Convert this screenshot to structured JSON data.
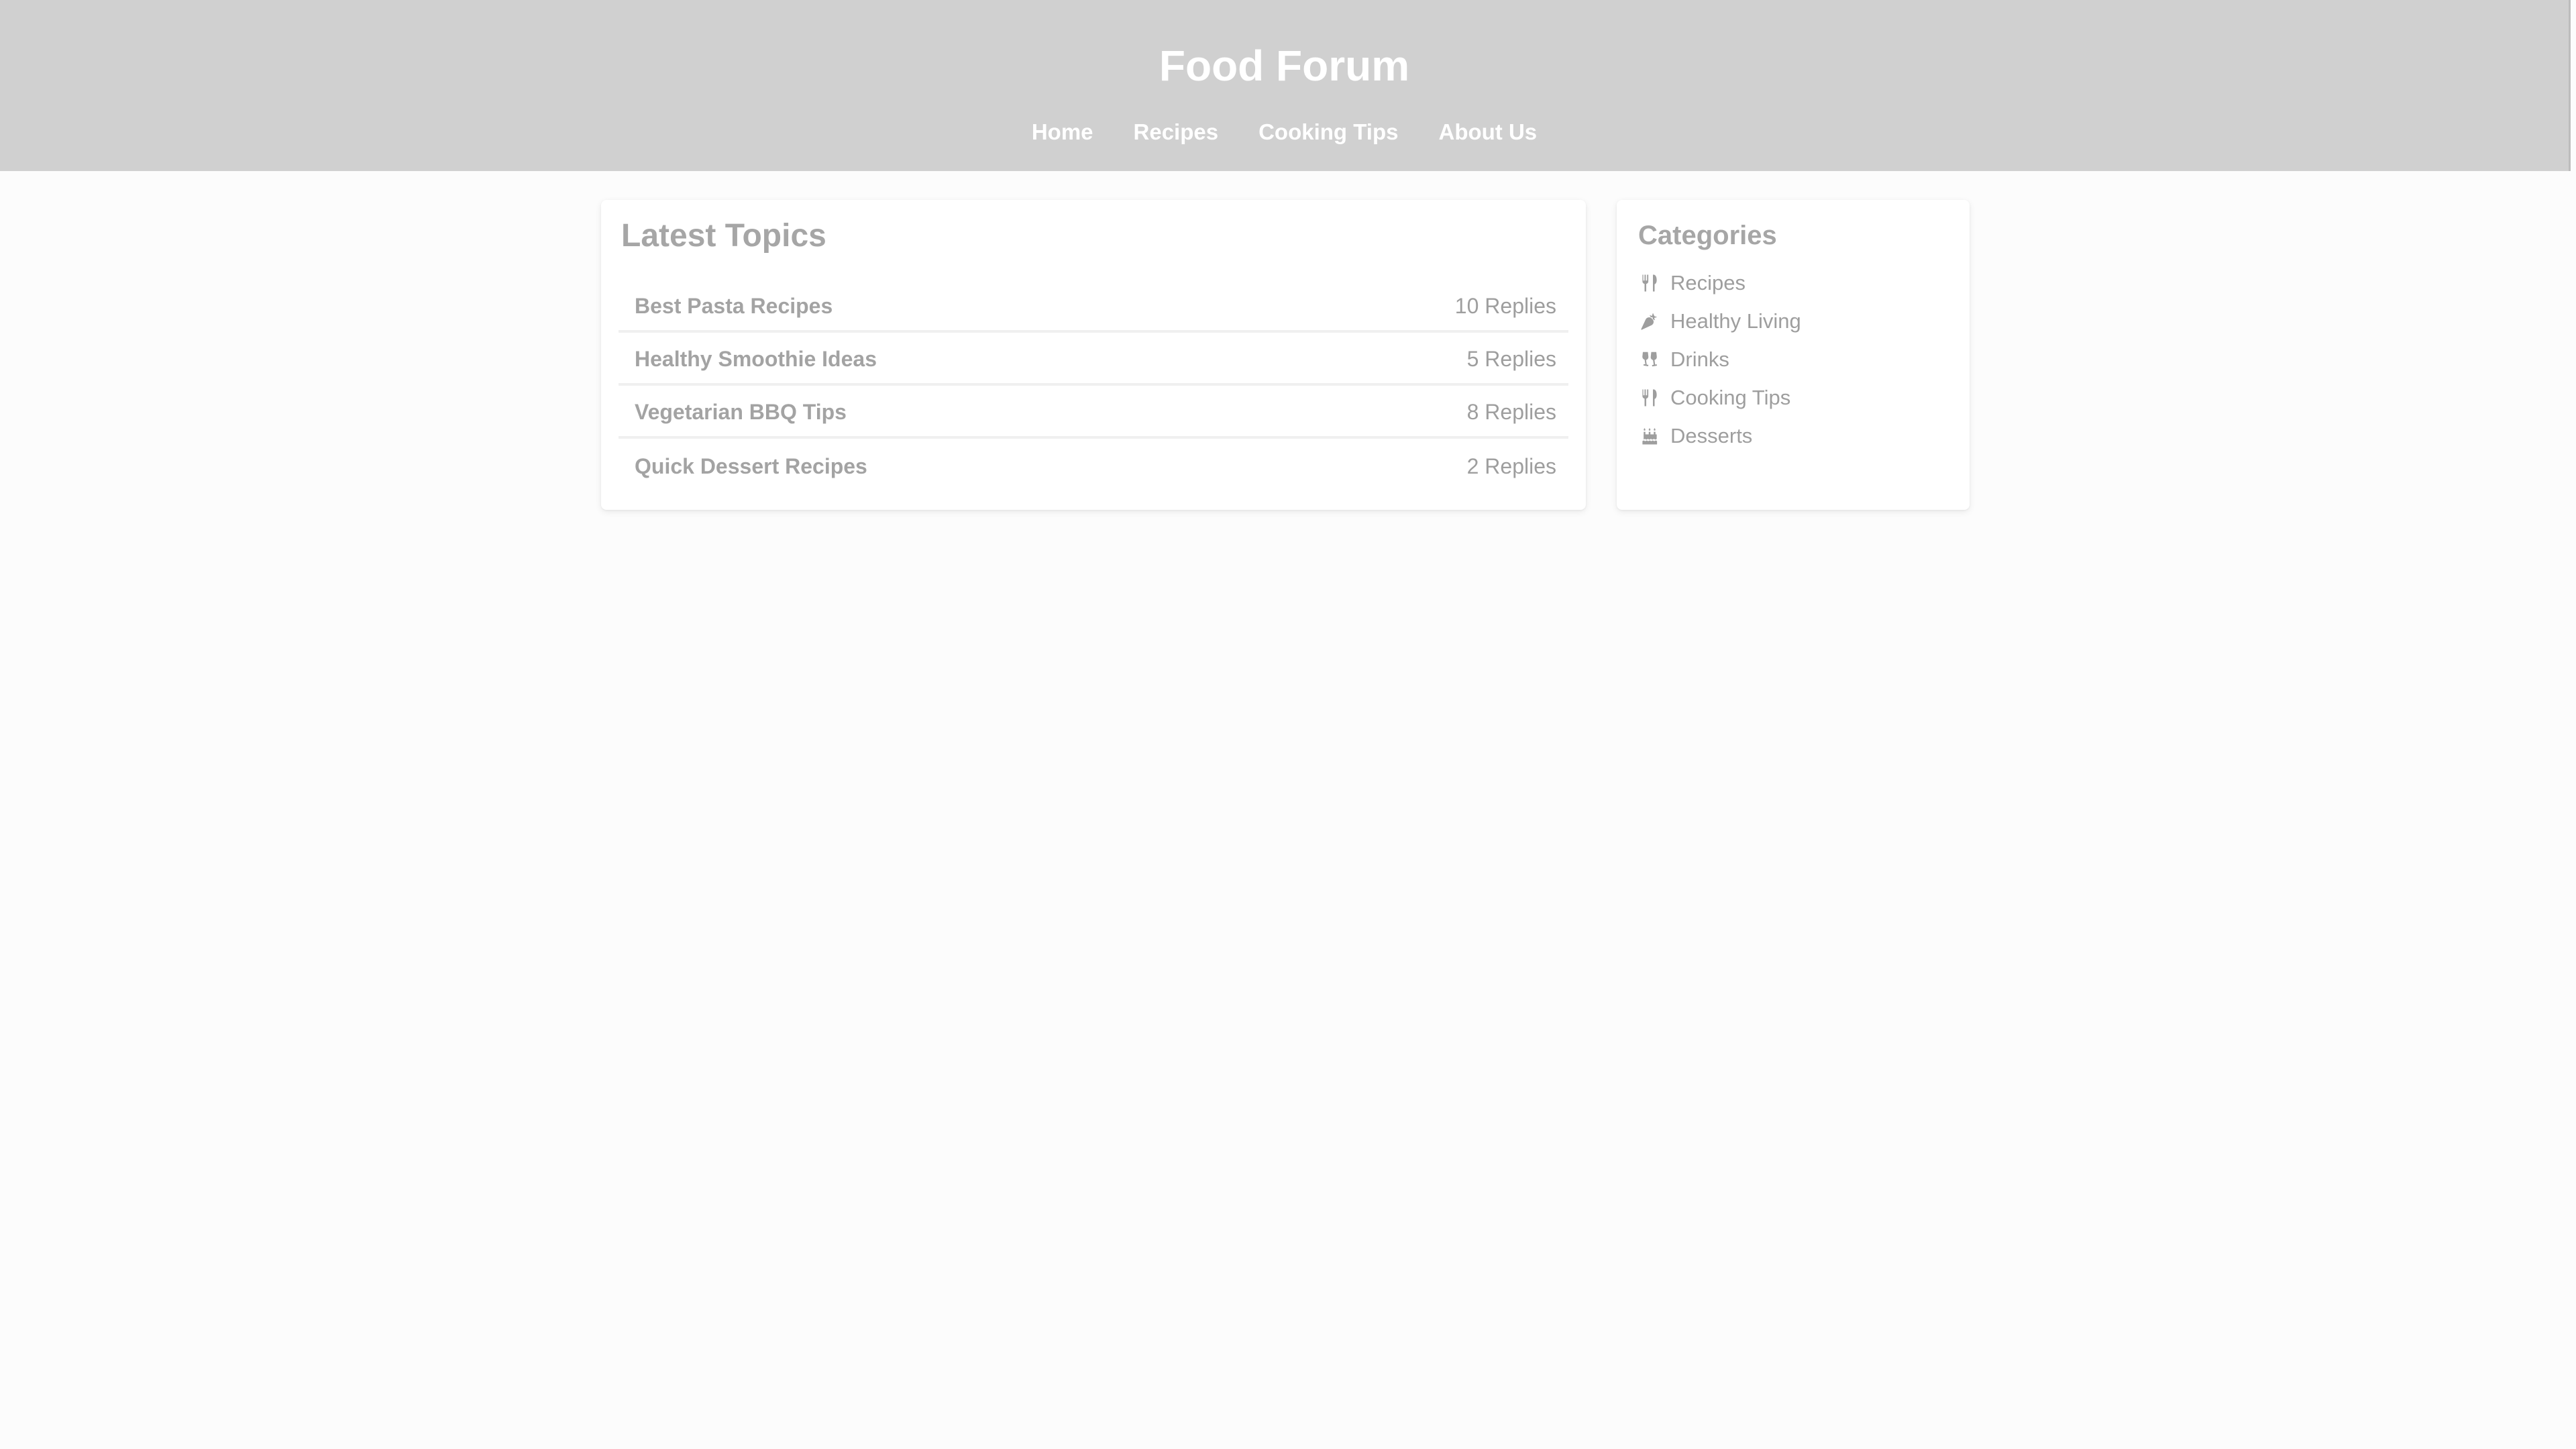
{
  "header": {
    "title": "Food Forum",
    "nav": [
      {
        "label": "Home"
      },
      {
        "label": "Recipes"
      },
      {
        "label": "Cooking Tips"
      },
      {
        "label": "About Us"
      }
    ]
  },
  "topics": {
    "heading": "Latest Topics",
    "items": [
      {
        "title": "Best Pasta Recipes",
        "replies": "10 Replies"
      },
      {
        "title": "Healthy Smoothie Ideas",
        "replies": "5 Replies"
      },
      {
        "title": "Vegetarian BBQ Tips",
        "replies": "8 Replies"
      },
      {
        "title": "Quick Dessert Recipes",
        "replies": "2 Replies"
      }
    ]
  },
  "categories": {
    "heading": "Categories",
    "items": [
      {
        "label": "Recipes",
        "icon": "utensils-icon"
      },
      {
        "label": "Healthy Living",
        "icon": "carrot-icon"
      },
      {
        "label": "Drinks",
        "icon": "glass-cheers-icon"
      },
      {
        "label": "Cooking Tips",
        "icon": "utensils-icon"
      },
      {
        "label": "Desserts",
        "icon": "birthday-cake-icon"
      }
    ]
  },
  "colors": {
    "header_bg": "#d0d0d0",
    "page_bg": "#fcfcfc",
    "text_muted": "#9e9e9e",
    "header_text": "#ffffff"
  }
}
